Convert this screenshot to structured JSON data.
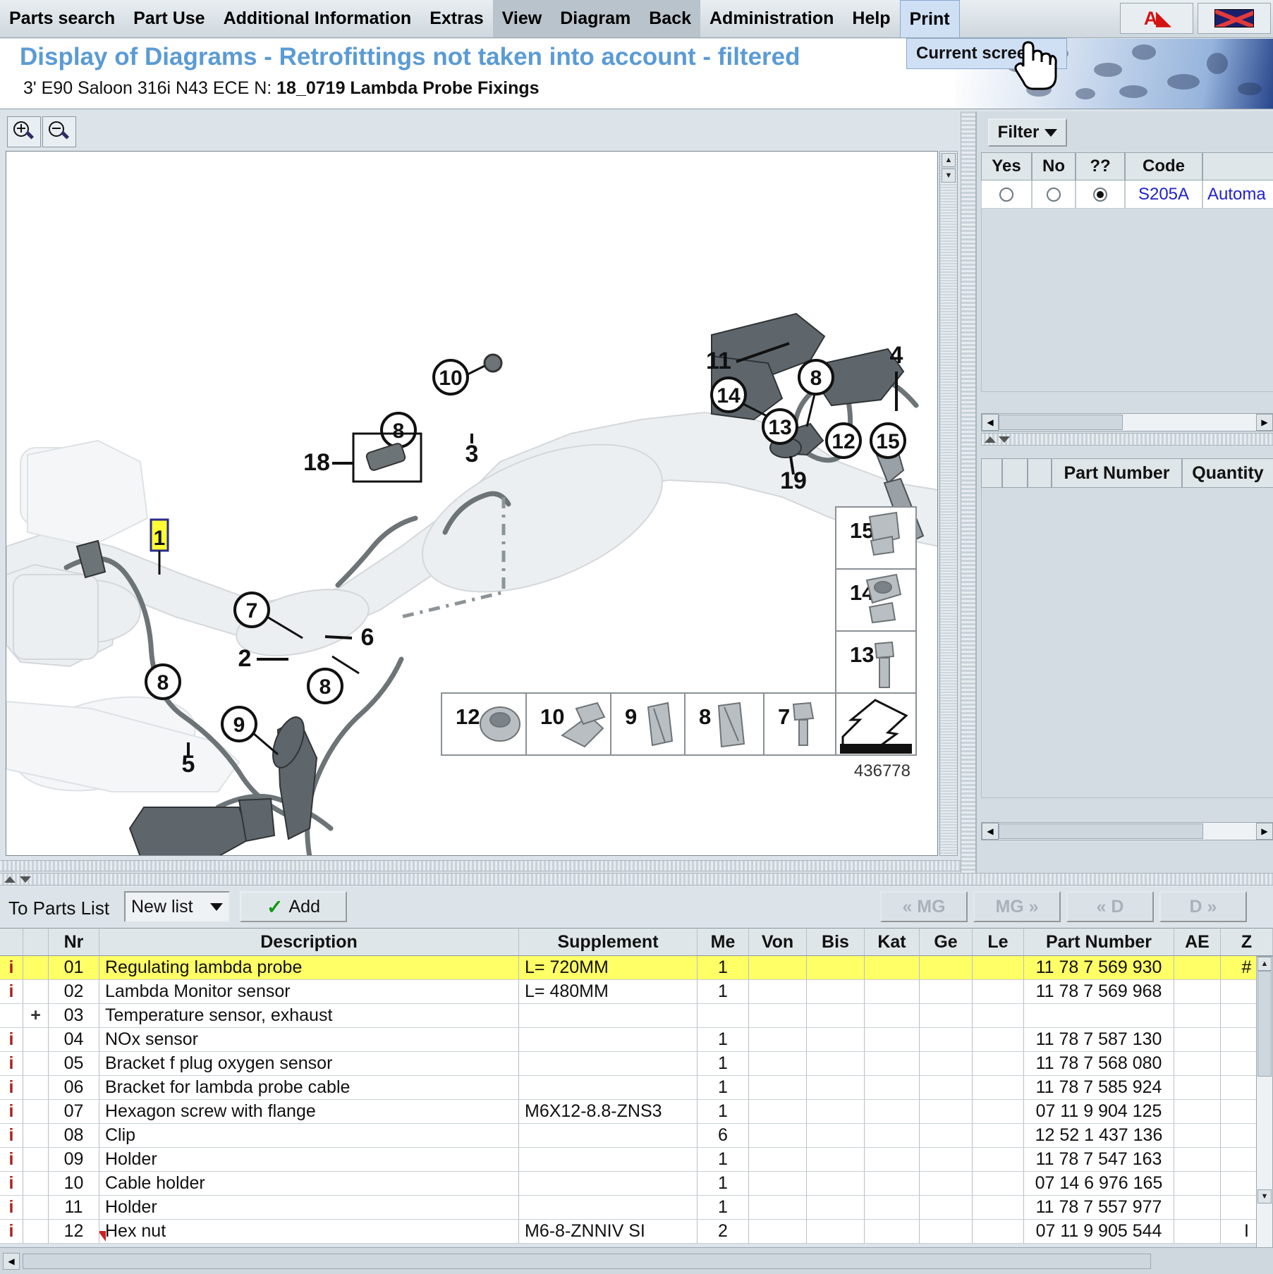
{
  "menu": {
    "items": [
      {
        "label": "Parts search",
        "state": "normal"
      },
      {
        "label": "Part Use",
        "state": "normal"
      },
      {
        "label": "Additional Information",
        "state": "normal"
      },
      {
        "label": "Extras",
        "state": "normal"
      },
      {
        "label": "View",
        "state": "active"
      },
      {
        "label": "Diagram",
        "state": "active"
      },
      {
        "label": "Back",
        "state": "active"
      },
      {
        "label": "Administration",
        "state": "normal"
      },
      {
        "label": "Help",
        "state": "normal"
      },
      {
        "label": "Print",
        "state": "open"
      }
    ],
    "dropdown_item": "Current screen",
    "toolbar_icons": [
      "font-size-icon",
      "language-flag-icon"
    ]
  },
  "title": {
    "main": "Display of Diagrams - Retrofittings not taken into account - filtered",
    "sub_prefix": "3' E90 Saloon 316i N43 ECE  N: ",
    "sub_bold": "18_0719 Lambda Probe Fixings"
  },
  "diagram": {
    "zoom_in_label": "zoom-in",
    "zoom_out_label": "zoom-out",
    "image_number": "436778",
    "callouts": [
      "11",
      "8",
      "4",
      "14",
      "13",
      "12",
      "15",
      "19",
      "10",
      "3",
      "18",
      "1",
      "7",
      "6",
      "2",
      "8",
      "8",
      "9",
      "5"
    ],
    "legend_bottom": [
      "12",
      "10",
      "9",
      "8",
      "7"
    ],
    "legend_right": [
      "15",
      "14",
      "13"
    ]
  },
  "filter": {
    "button_label": "Filter",
    "columns": [
      "Yes",
      "No",
      "??",
      "Code",
      ""
    ],
    "rows": [
      {
        "yes": false,
        "no": false,
        "unknown": true,
        "code": "S205A",
        "description": "Automa"
      }
    ]
  },
  "partnumber_panel": {
    "columns": [
      "",
      "",
      "",
      "Part Number",
      "Quantity"
    ]
  },
  "parts_toolbar": {
    "to_parts_list_label": "To Parts List",
    "list_select_value": "New list",
    "add_label": "Add",
    "nav_buttons": [
      "« MG",
      "MG »",
      "« D",
      "D »"
    ]
  },
  "parts_table": {
    "columns": [
      "",
      "",
      "Nr",
      "Description",
      "Supplement",
      "Me",
      "Von",
      "Bis",
      "Kat",
      "Ge",
      "Le",
      "Part Number",
      "AE",
      "Z"
    ],
    "rows": [
      {
        "info": "i",
        "expand": "",
        "nr": "01",
        "description": "Regulating lambda probe",
        "supplement": "L= 720MM",
        "me": "1",
        "von": "",
        "bis": "",
        "kat": "",
        "ge": "",
        "le": "",
        "part_number": "11 78 7 569 930",
        "ae": "",
        "z": "#",
        "selected": true,
        "flag": false
      },
      {
        "info": "i",
        "expand": "",
        "nr": "02",
        "description": "Lambda Monitor sensor",
        "supplement": "L= 480MM",
        "me": "1",
        "von": "",
        "bis": "",
        "kat": "",
        "ge": "",
        "le": "",
        "part_number": "11 78 7 569 968",
        "ae": "",
        "z": "",
        "selected": false,
        "flag": false
      },
      {
        "info": "",
        "expand": "+",
        "nr": "03",
        "description": "Temperature sensor, exhaust",
        "supplement": "",
        "me": "",
        "von": "",
        "bis": "",
        "kat": "",
        "ge": "",
        "le": "",
        "part_number": "",
        "ae": "",
        "z": "",
        "selected": false,
        "flag": false
      },
      {
        "info": "i",
        "expand": "",
        "nr": "04",
        "description": "NOx sensor",
        "supplement": "",
        "me": "1",
        "von": "",
        "bis": "",
        "kat": "",
        "ge": "",
        "le": "",
        "part_number": "11 78 7 587 130",
        "ae": "",
        "z": "",
        "selected": false,
        "flag": false
      },
      {
        "info": "i",
        "expand": "",
        "nr": "05",
        "description": "Bracket f plug oxygen sensor",
        "supplement": "",
        "me": "1",
        "von": "",
        "bis": "",
        "kat": "",
        "ge": "",
        "le": "",
        "part_number": "11 78 7 568 080",
        "ae": "",
        "z": "",
        "selected": false,
        "flag": false
      },
      {
        "info": "i",
        "expand": "",
        "nr": "06",
        "description": "Bracket for lambda probe cable",
        "supplement": "",
        "me": "1",
        "von": "",
        "bis": "",
        "kat": "",
        "ge": "",
        "le": "",
        "part_number": "11 78 7 585 924",
        "ae": "",
        "z": "",
        "selected": false,
        "flag": false
      },
      {
        "info": "i",
        "expand": "",
        "nr": "07",
        "description": "Hexagon screw with flange",
        "supplement": "M6X12-8.8-ZNS3",
        "me": "1",
        "von": "",
        "bis": "",
        "kat": "",
        "ge": "",
        "le": "",
        "part_number": "07 11 9 904 125",
        "ae": "",
        "z": "",
        "selected": false,
        "flag": false
      },
      {
        "info": "i",
        "expand": "",
        "nr": "08",
        "description": "Clip",
        "supplement": "",
        "me": "6",
        "von": "",
        "bis": "",
        "kat": "",
        "ge": "",
        "le": "",
        "part_number": "12 52 1 437 136",
        "ae": "",
        "z": "",
        "selected": false,
        "flag": false
      },
      {
        "info": "i",
        "expand": "",
        "nr": "09",
        "description": "Holder",
        "supplement": "",
        "me": "1",
        "von": "",
        "bis": "",
        "kat": "",
        "ge": "",
        "le": "",
        "part_number": "11 78 7 547 163",
        "ae": "",
        "z": "",
        "selected": false,
        "flag": false
      },
      {
        "info": "i",
        "expand": "",
        "nr": "10",
        "description": "Cable holder",
        "supplement": "",
        "me": "1",
        "von": "",
        "bis": "",
        "kat": "",
        "ge": "",
        "le": "",
        "part_number": "07 14 6 976 165",
        "ae": "",
        "z": "",
        "selected": false,
        "flag": false
      },
      {
        "info": "i",
        "expand": "",
        "nr": "11",
        "description": "Holder",
        "supplement": "",
        "me": "1",
        "von": "",
        "bis": "",
        "kat": "",
        "ge": "",
        "le": "",
        "part_number": "11 78 7 557 977",
        "ae": "",
        "z": "",
        "selected": false,
        "flag": false
      },
      {
        "info": "i",
        "expand": "",
        "nr": "12",
        "description": "Hex nut",
        "supplement": "M6-8-ZNNIV SI",
        "me": "2",
        "von": "",
        "bis": "",
        "kat": "",
        "ge": "",
        "le": "",
        "part_number": "07 11 9 905 544",
        "ae": "",
        "z": "I",
        "selected": false,
        "flag": true
      }
    ]
  },
  "colors": {
    "title_blue": "#5b9bd5",
    "selected_row": "#ffff66",
    "link_blue": "#2222cc",
    "info_red": "#aa2222",
    "panel_bg": "#d4dce3"
  }
}
